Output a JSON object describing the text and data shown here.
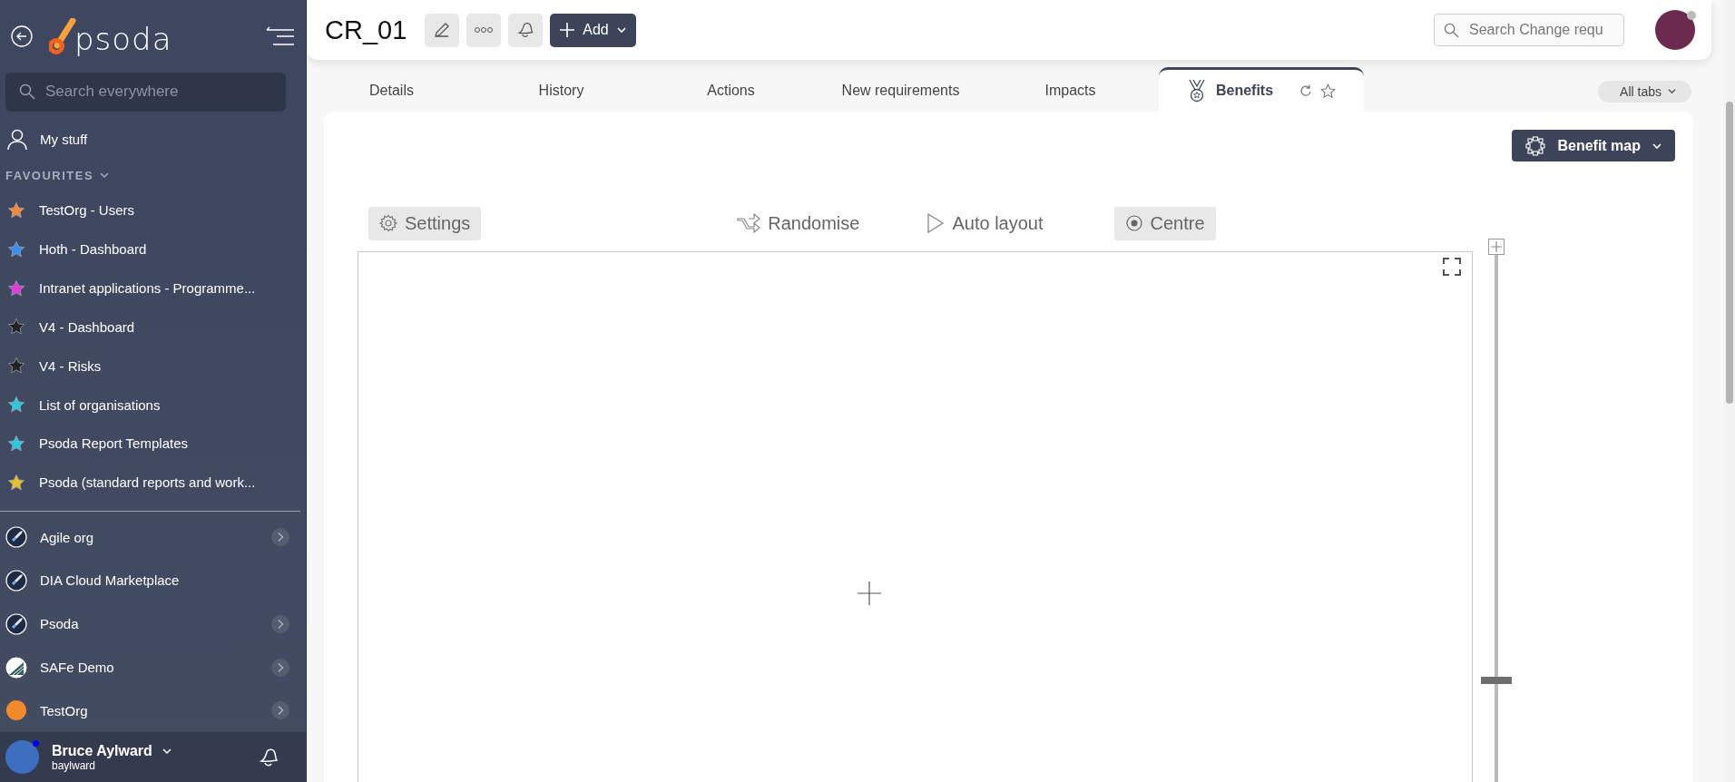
{
  "sidebar": {
    "logo_text": "psoda",
    "search": {
      "placeholder": "Search everywhere"
    },
    "my_stuff": "My stuff",
    "favourites_heading": "FAVOURITES",
    "favourites": [
      {
        "label": "TestOrg - Users",
        "color": "#f5883a"
      },
      {
        "label": "Hoth - Dashboard",
        "color": "#3b8ff0"
      },
      {
        "label": "Intranet applications - Programme...",
        "color": "#e03ad8"
      },
      {
        "label": "V4 - Dashboard",
        "color": "#222222"
      },
      {
        "label": "V4 - Risks",
        "color": "#222222"
      },
      {
        "label": "List of organisations",
        "color": "#2ec8dc"
      },
      {
        "label": "Psoda Report Templates",
        "color": "#2ec8dc"
      },
      {
        "label": "Psoda (standard reports and work...",
        "color": "#e8c02a"
      }
    ],
    "organisations": [
      {
        "label": "Agile org",
        "kind": "rocket",
        "expandable": true
      },
      {
        "label": "DIA Cloud Marketplace",
        "kind": "rocket",
        "expandable": false
      },
      {
        "label": "Psoda",
        "kind": "rocket",
        "expandable": true
      },
      {
        "label": "SAFe Demo",
        "kind": "stripes",
        "expandable": true
      },
      {
        "label": "TestOrg",
        "kind": "sunset",
        "expandable": true
      }
    ],
    "user": {
      "name": "Bruce Aylward",
      "username": "baylward",
      "online": true
    }
  },
  "header": {
    "title": "CR_01",
    "add_button": "Add",
    "search": {
      "placeholder": "Search Change requ"
    }
  },
  "tabs": [
    {
      "label": "Details",
      "selected": false
    },
    {
      "label": "History",
      "selected": false
    },
    {
      "label": "Actions",
      "selected": false
    },
    {
      "label": "New requirements",
      "selected": false
    },
    {
      "label": "Impacts",
      "selected": false
    },
    {
      "label": "Benefits",
      "selected": true
    }
  ],
  "all_tabs": "All tabs",
  "benefit_map_button": "Benefit map",
  "toolbar": [
    {
      "label": "Settings",
      "kind": "settings",
      "highlighted": true
    },
    {
      "label": "Randomise",
      "kind": "randomise",
      "highlighted": false
    },
    {
      "label": "Auto layout",
      "kind": "auto_layout",
      "highlighted": false
    },
    {
      "label": "Centre",
      "kind": "centre",
      "highlighted": true
    }
  ],
  "zoom_slider": {
    "level": 0.2
  }
}
